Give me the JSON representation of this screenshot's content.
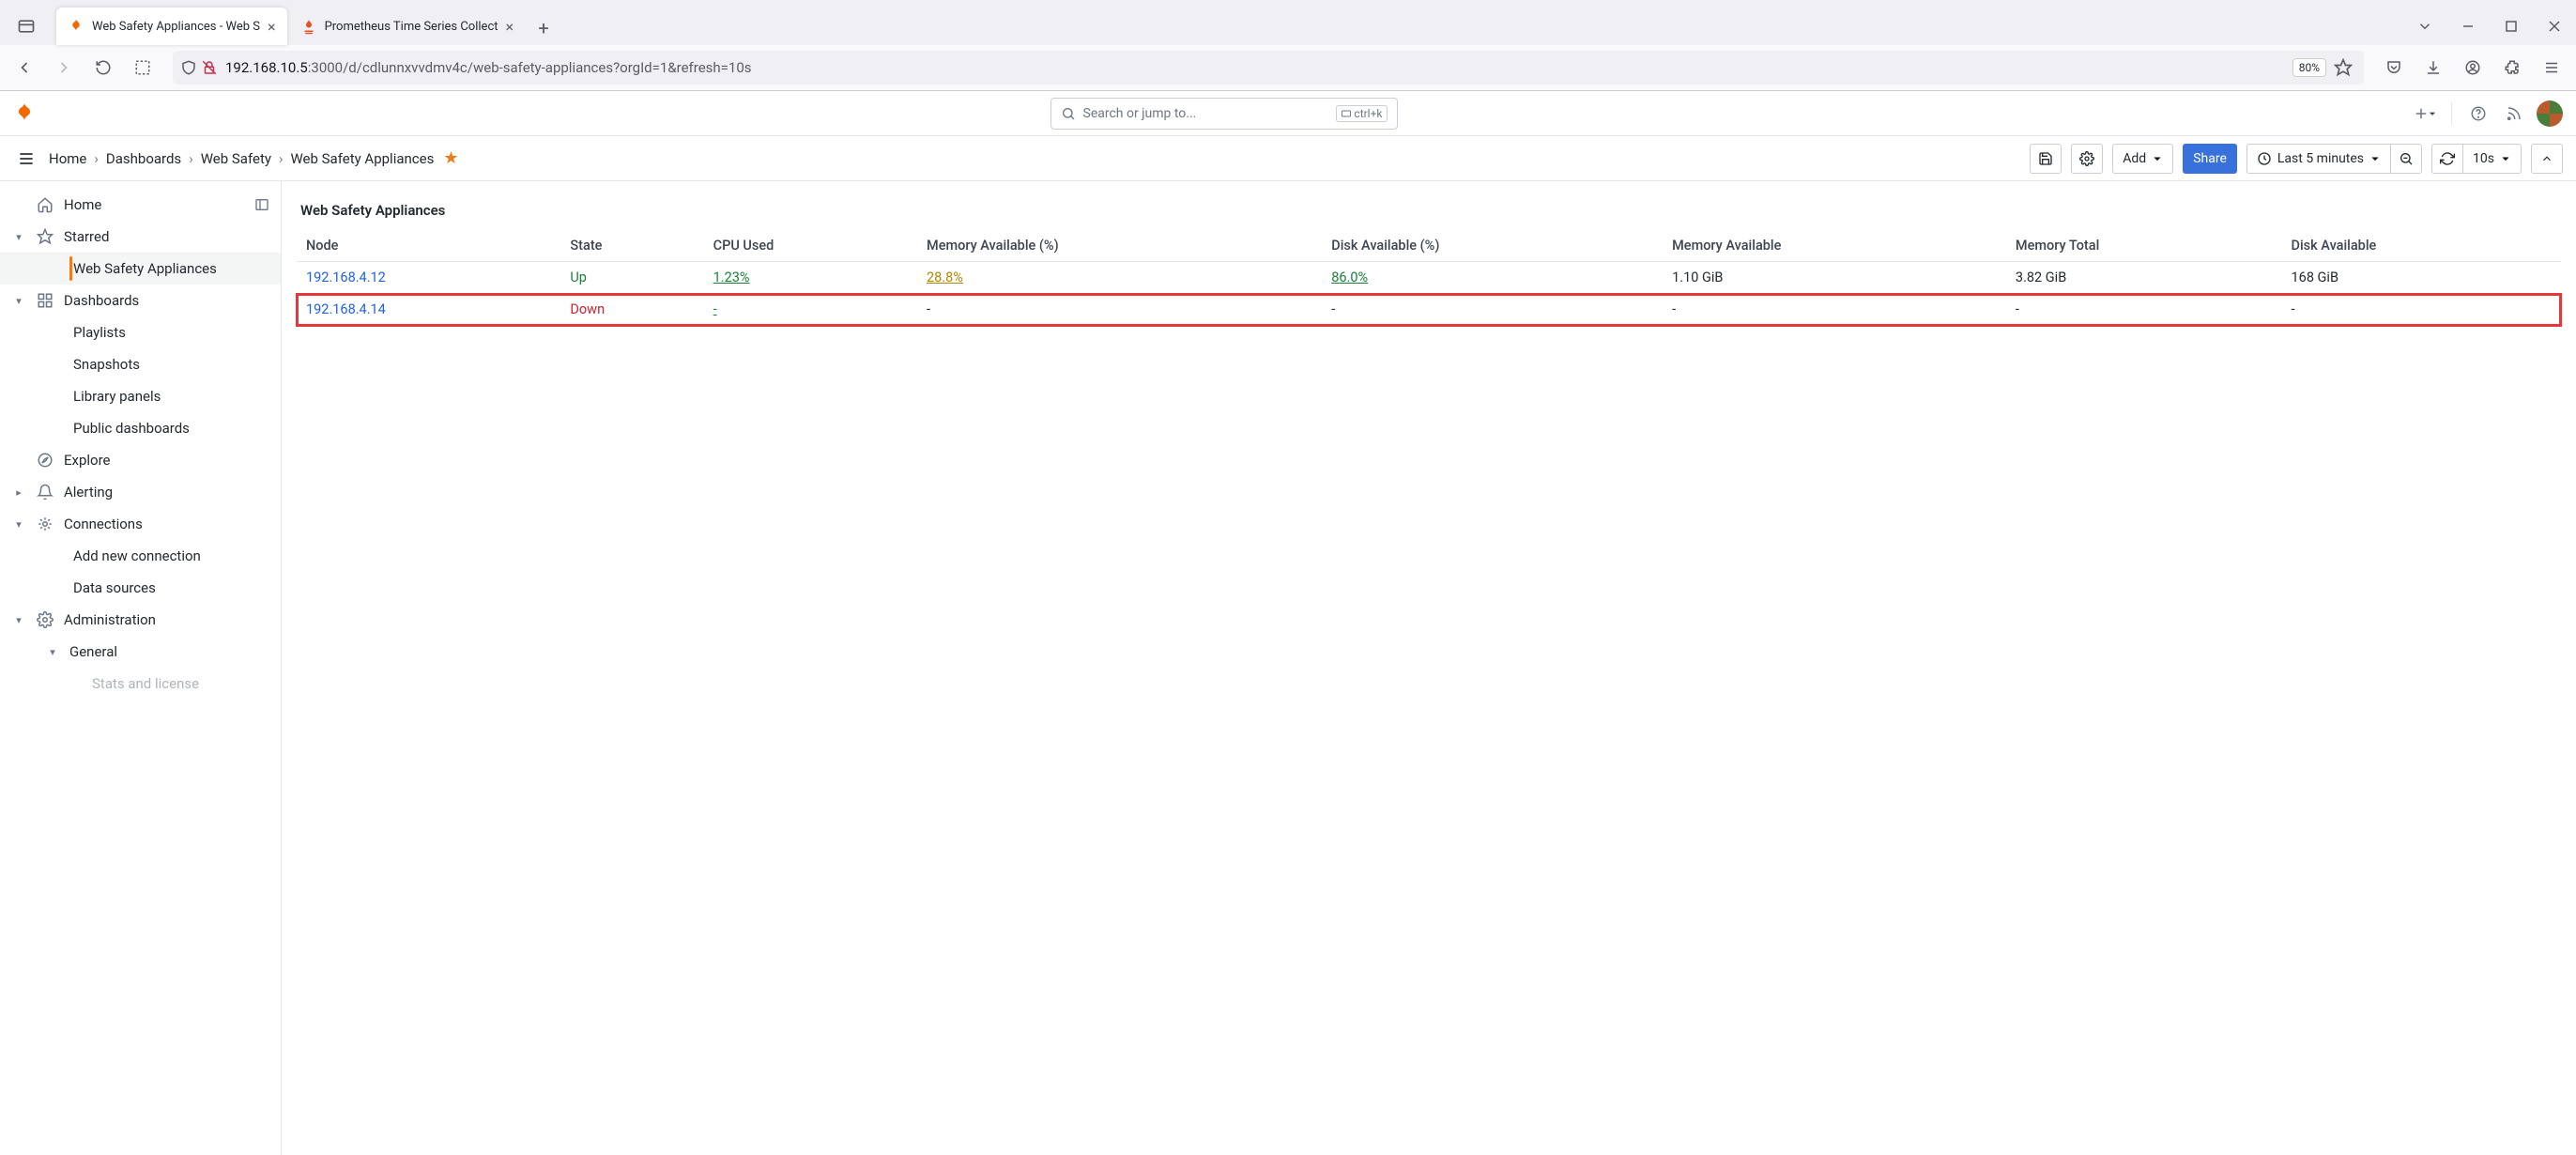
{
  "browser": {
    "tabs": [
      {
        "title": "Web Safety Appliances - Web S",
        "active": true,
        "favicon": "grafana"
      },
      {
        "title": "Prometheus Time Series Collect",
        "active": false,
        "favicon": "prometheus"
      }
    ],
    "url_host": "192.168.10.5",
    "url_rest": ":3000/d/cdlunnxvvdmv4c/web-safety-appliances?orgId=1&refresh=10s",
    "zoom": "80%"
  },
  "header": {
    "search_placeholder": "Search or jump to...",
    "shortcut": "ctrl+k"
  },
  "breadcrumbs": [
    "Home",
    "Dashboards",
    "Web Safety",
    "Web Safety Appliances"
  ],
  "toolbar": {
    "add_label": "Add",
    "share_label": "Share",
    "time_range": "Last 5 minutes",
    "refresh_interval": "10s"
  },
  "sidebar": [
    {
      "type": "item",
      "chev": "",
      "icon": "home",
      "label": "Home",
      "right": "panel"
    },
    {
      "type": "item",
      "chev": "down",
      "icon": "star",
      "label": "Starred"
    },
    {
      "type": "child",
      "label": "Web Safety Appliances",
      "active": true
    },
    {
      "type": "item",
      "chev": "down",
      "icon": "apps",
      "label": "Dashboards"
    },
    {
      "type": "child",
      "label": "Playlists"
    },
    {
      "type": "child",
      "label": "Snapshots"
    },
    {
      "type": "child",
      "label": "Library panels"
    },
    {
      "type": "child",
      "label": "Public dashboards"
    },
    {
      "type": "item",
      "chev": "",
      "icon": "compass",
      "label": "Explore"
    },
    {
      "type": "item",
      "chev": "right",
      "icon": "bell",
      "label": "Alerting"
    },
    {
      "type": "item",
      "chev": "down",
      "icon": "plug",
      "label": "Connections"
    },
    {
      "type": "child",
      "label": "Add new connection"
    },
    {
      "type": "child",
      "label": "Data sources"
    },
    {
      "type": "item",
      "chev": "down",
      "icon": "gear",
      "label": "Administration"
    },
    {
      "type": "item2",
      "chev": "down",
      "label": "General"
    },
    {
      "type": "child2",
      "label": "Stats and license",
      "faded": true
    }
  ],
  "panel": {
    "title": "Web Safety Appliances",
    "columns": [
      "Node",
      "State",
      "CPU Used",
      "Memory Available (%)",
      "Disk Available (%)",
      "Memory Available",
      "Memory Total",
      "Disk Available"
    ],
    "rows": [
      {
        "node": "192.168.4.12",
        "state": "Up",
        "state_class": "state-up",
        "cpu": "1.23%",
        "cpu_class": "val-green",
        "memp": "28.8%",
        "memp_class": "val-yellow",
        "diskp": "86.0%",
        "diskp_class": "val-green",
        "mem": "1.10 GiB",
        "memt": "3.82 GiB",
        "disk": "168 GiB",
        "highlight": false
      },
      {
        "node": "192.168.4.14",
        "state": "Down",
        "state_class": "state-down",
        "cpu": "-",
        "cpu_class": "val-green",
        "memp": "-",
        "memp_class": "",
        "diskp": "-",
        "diskp_class": "",
        "mem": "-",
        "memt": "-",
        "disk": "-",
        "highlight": true
      }
    ]
  }
}
